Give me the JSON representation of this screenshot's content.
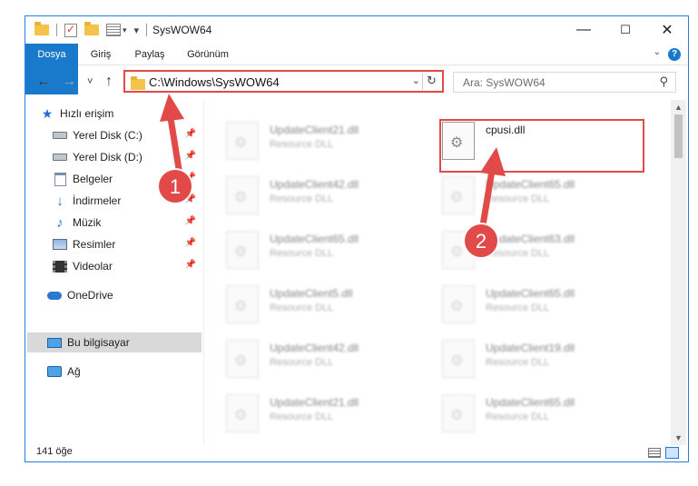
{
  "window": {
    "title": "SysWOW64",
    "controls": {
      "minimize": "—",
      "maximize": "☐",
      "close": "✕"
    }
  },
  "ribbon": {
    "tabs": [
      {
        "label": "Dosya"
      },
      {
        "label": "Giriş"
      },
      {
        "label": "Paylaş"
      },
      {
        "label": "Görünüm"
      }
    ],
    "help": "?"
  },
  "nav": {
    "back": "←",
    "forward": "→",
    "recent": "˅",
    "up": "↑",
    "address": "C:\\Windows\\SysWOW64",
    "search_placeholder": "Ara: SysWOW64"
  },
  "sidebar": {
    "items": [
      {
        "label": "Hızlı erişim",
        "icon": "star-icon"
      },
      {
        "label": "Yerel Disk (C:)",
        "icon": "disk-icon",
        "pinned": true
      },
      {
        "label": "Yerel Disk (D:)",
        "icon": "disk-icon",
        "pinned": true
      },
      {
        "label": "Belgeler",
        "icon": "documents-icon",
        "pinned": true
      },
      {
        "label": "İndirmeler",
        "icon": "downloads-icon",
        "pinned": true
      },
      {
        "label": "Müzik",
        "icon": "music-icon",
        "pinned": true
      },
      {
        "label": "Resimler",
        "icon": "pictures-icon",
        "pinned": true
      },
      {
        "label": "Videolar",
        "icon": "videos-icon",
        "pinned": true
      },
      {
        "label": "OneDrive",
        "icon": "cloud-icon"
      },
      {
        "label": "Bu bilgisayar",
        "icon": "computer-icon",
        "selected": true
      },
      {
        "label": "Ağ",
        "icon": "network-icon"
      }
    ]
  },
  "files": {
    "left": [
      {
        "name": "UpdateClient21.dll",
        "type": "Resource DLL"
      },
      {
        "name": "UpdateClient42.dll",
        "type": "Resource DLL"
      },
      {
        "name": "UpdateClient65.dll",
        "type": "Resource DLL"
      },
      {
        "name": "UpdateClient5.dll",
        "type": "Resource DLL"
      },
      {
        "name": "UpdateClient42.dll",
        "type": "Resource DLL"
      },
      {
        "name": "UpdateClient21.dll",
        "type": "Resource DLL"
      }
    ],
    "right": [
      {
        "name": "cpusi.dll",
        "type": ""
      },
      {
        "name": "UpdateClient65.dll",
        "type": "Resource DLL"
      },
      {
        "name": "UpdateClient63.dll",
        "type": "Resource DLL"
      },
      {
        "name": "UpdateClient65.dll",
        "type": "Resource DLL"
      },
      {
        "name": "UpdateClient19.dll",
        "type": "Resource DLL"
      },
      {
        "name": "UpdateClient65.dll",
        "type": "Resource DLL"
      }
    ]
  },
  "status": {
    "count": "141 öğe"
  },
  "annotations": {
    "step1": "1",
    "step2": "2",
    "color": "#e24a4a"
  }
}
